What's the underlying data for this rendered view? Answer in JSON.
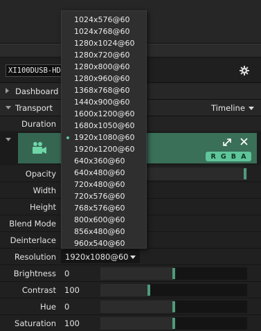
{
  "device": {
    "name": "XI100DUSB-HDMI"
  },
  "sections": {
    "dashboard": "Dashboard",
    "transport": "Transport",
    "timeline": "Timeline"
  },
  "duration_label": "Duration",
  "clip": {
    "channels": [
      "R",
      "G",
      "B",
      "A"
    ]
  },
  "params": {
    "opacity": "Opacity",
    "width": "Width",
    "height": "Height",
    "blend_mode": "Blend Mode",
    "deinterlace": "Deinterlace",
    "resolution": "Resolution",
    "brightness": "Brightness",
    "contrast": "Contrast",
    "hue": "Hue",
    "saturation": "Saturation"
  },
  "values": {
    "resolution": "1920x1080@60",
    "brightness": "0",
    "contrast": "100",
    "hue": "0",
    "saturation": "100"
  },
  "slider_levels": {
    "opacity": 1.0,
    "brightness": 0.5,
    "contrast": 0.33,
    "hue": 0.5,
    "saturation": 0.5
  },
  "resolution_options": [
    "1024x576@60",
    "1024x768@60",
    "1280x1024@60",
    "1280x720@60",
    "1280x800@60",
    "1280x960@60",
    "1368x768@60",
    "1440x900@60",
    "1600x1200@60",
    "1680x1050@60",
    "1920x1080@60",
    "1920x1200@60",
    "640x360@60",
    "640x480@60",
    "720x480@60",
    "720x576@60",
    "768x576@60",
    "800x600@60",
    "856x480@60",
    "960x540@60"
  ],
  "selected_resolution_index": 10,
  "colors": {
    "accent": "#5fc59a",
    "clip": "#3a6f58"
  }
}
